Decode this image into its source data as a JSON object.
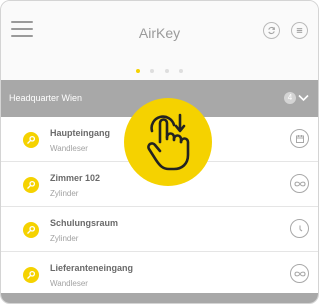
{
  "header": {
    "title": "AirKey",
    "menu_icon": "hamburger-menu-icon",
    "sync_icon": "sync-icon",
    "list_icon": "list-icon"
  },
  "pager": {
    "total": 4,
    "active_index": 0
  },
  "site": {
    "name": "Headquarter Wien",
    "count": "4"
  },
  "entries": [
    {
      "name": "Haupteingang",
      "type": "Wandleser",
      "icon": "calendar-icon"
    },
    {
      "name": "Zimmer 102",
      "type": "Zylinder",
      "icon": "infinity-icon"
    },
    {
      "name": "Schulungsraum",
      "type": "Zylinder",
      "icon": "clock-icon"
    },
    {
      "name": "Lieferanteneingang",
      "type": "Wandleser",
      "icon": "infinity-icon"
    }
  ],
  "gesture": {
    "icon": "pull-down-hand-icon"
  },
  "colors": {
    "accent": "#f5d200",
    "bar": "#a8a8a8",
    "text": "#6a6a6a"
  }
}
